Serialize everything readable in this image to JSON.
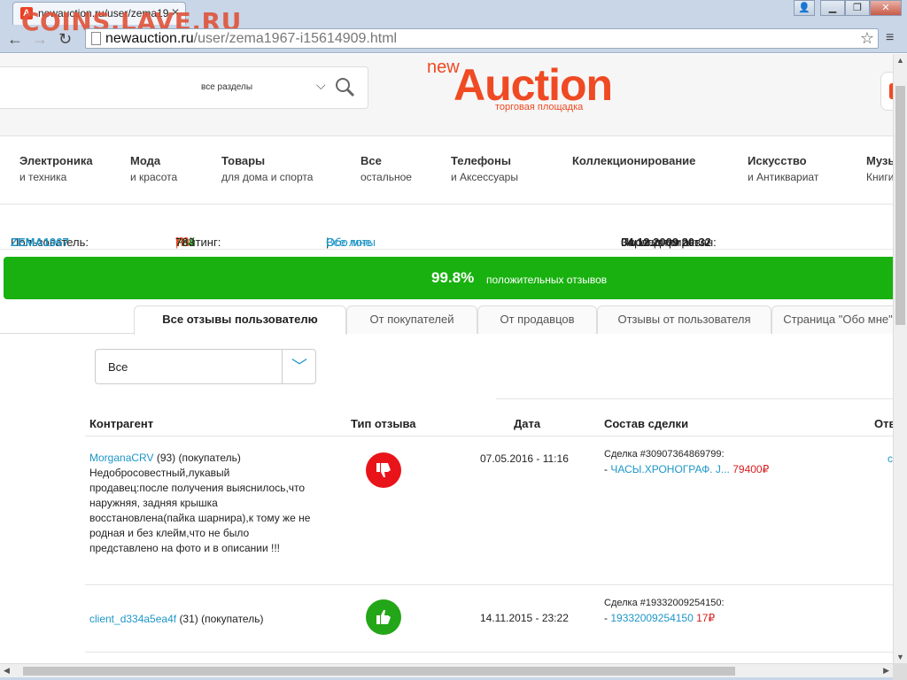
{
  "browser": {
    "tab_title": "newauction.ru/user/zema19",
    "tab_favicon": "A",
    "watermark": "COINS.LAVE.RU",
    "url_host": "newauction.ru",
    "url_path": "/user/zema1967-i15614909.html"
  },
  "header": {
    "search_category": "все разделы",
    "logo_new": "new",
    "logo_name": "Auction",
    "logo_tagline": "торговая площадка"
  },
  "categories": [
    {
      "l1": "Электроника",
      "l2": "и техника"
    },
    {
      "l1": "Мода",
      "l2": "и красота"
    },
    {
      "l1": "Товары",
      "l2": "для дома и спорта"
    },
    {
      "l1": "Все",
      "l2": "остальное"
    },
    {
      "l1": "Телефоны",
      "l2": "и Аксессуары"
    },
    {
      "l1": "Коллекционирование",
      "l2": ""
    },
    {
      "l1": "Искусство",
      "l2": "и Антиквариат"
    },
    {
      "l1": "Музы",
      "l2": "Книги"
    }
  ],
  "user": {
    "user_label": "Пользователь:",
    "username": "ZEMA1967",
    "rating_label": "Рейтинг:",
    "rating": "784",
    "sep": "|",
    "m_rating": "783",
    "about_link": "Обо мне",
    "sep2": "|",
    "all_lots_link": "Все лоты",
    "registered_label": "Зарегистрирован:",
    "registered_date": "04.12.2009 20:32",
    "last_activity_label": "Последняя акт"
  },
  "rating_bar": {
    "percent": "99.8%",
    "text": "положительных отзывов"
  },
  "tabs": [
    "Все отзывы пользователю",
    "От покупателей",
    "От продавцов",
    "Отзывы от пользователя",
    "Страница \"Обо мне\""
  ],
  "filter": {
    "value": "Все"
  },
  "table": {
    "headers": [
      "Контрагент",
      "Тип отзыва",
      "Дата",
      "Состав сделки",
      "Отв"
    ],
    "rows": [
      {
        "user": "MorganaCRV",
        "user_meta": "(93) (покупатель)",
        "comment": "Недобросовестный,лукавый продавец:после получения выяснилось,что наружняя, задняя крышка восстановлена(пайка шарнира),к тому же не родная и без клейм,что не было представлено на фото и в описании !!!",
        "type": "negative",
        "date": "07.05.2016 - 11:16",
        "deal_label": "Сделка #30907364869799:",
        "deal_dash": "- ",
        "deal_item": "ЧАСЫ.ХРОНОГРАФ. J...",
        "deal_price": "79400₽",
        "answer": "с"
      },
      {
        "user": "client_d334a5ea4f",
        "user_meta": "(31) (покупатель)",
        "comment": "",
        "type": "positive",
        "date": "14.11.2015 - 23:22",
        "deal_label": "Сделка #19332009254150:",
        "deal_dash": "- ",
        "deal_item": "19332009254150",
        "deal_price": "17₽",
        "answer": ""
      }
    ]
  },
  "colors": {
    "brand": "#ef4a23",
    "link": "#1e96c8",
    "positive": "#18b10f",
    "negative": "#e8141a",
    "price": "#d81e1e"
  }
}
